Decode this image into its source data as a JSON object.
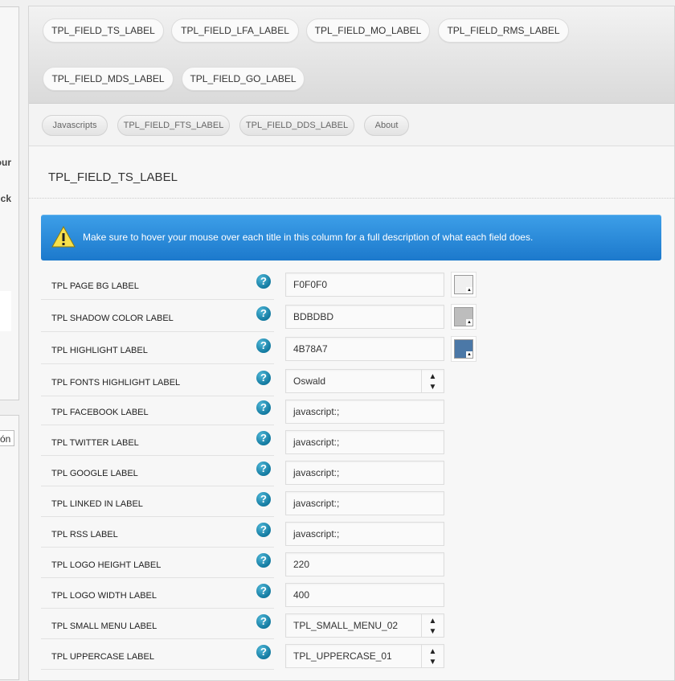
{
  "left_fragments": [
    "our",
    "ck"
  ],
  "left_input_value": "ón",
  "tabs": [
    "TPL_FIELD_TS_LABEL",
    "TPL_FIELD_LFA_LABEL",
    "TPL_FIELD_MO_LABEL",
    "TPL_FIELD_RMS_LABEL",
    "TPL_FIELD_MDS_LABEL",
    "TPL_FIELD_GO_LABEL"
  ],
  "subtabs": [
    "Javascripts",
    "TPL_FIELD_FTS_LABEL",
    "TPL_FIELD_DDS_LABEL",
    "About"
  ],
  "section_title": "TPL_FIELD_TS_LABEL",
  "alert_text": "Make sure to hover your mouse over each title in this column for a full description of what each field does.",
  "help_glyph": "?",
  "select_glyph": "▲\n▼",
  "swatch_corner_glyph": "▲",
  "rows": [
    {
      "label": "TPL PAGE BG LABEL",
      "value": "F0F0F0",
      "type": "color",
      "color": "#F0F0F0"
    },
    {
      "label": "TPL SHADOW COLOR LABEL",
      "value": "BDBDBD",
      "type": "color",
      "color": "#BDBDBD"
    },
    {
      "label": "TPL HIGHLIGHT LABEL",
      "value": "4B78A7",
      "type": "color",
      "color": "#4B78A7"
    },
    {
      "label": "TPL FONTS HIGHLIGHT LABEL",
      "value": "Oswald",
      "type": "select"
    },
    {
      "label": "TPL FACEBOOK LABEL",
      "value": "javascript:;",
      "type": "text"
    },
    {
      "label": "TPL TWITTER LABEL",
      "value": "javascript:;",
      "type": "text"
    },
    {
      "label": "TPL GOOGLE LABEL",
      "value": "javascript:;",
      "type": "text"
    },
    {
      "label": "TPL LINKED IN LABEL",
      "value": "javascript:;",
      "type": "text"
    },
    {
      "label": "TPL RSS LABEL",
      "value": "javascript:;",
      "type": "text"
    },
    {
      "label": "TPL LOGO HEIGHT LABEL",
      "value": "220",
      "type": "text"
    },
    {
      "label": "TPL LOGO WIDTH LABEL",
      "value": "400",
      "type": "text"
    },
    {
      "label": "TPL SMALL MENU LABEL",
      "value": "TPL_SMALL_MENU_02",
      "type": "select"
    },
    {
      "label": "TPL UPPERCASE LABEL",
      "value": "TPL_UPPERCASE_01",
      "type": "select"
    }
  ],
  "colors": {
    "alert_top": "#3d9fe8",
    "alert_bottom": "#1c79cc",
    "help": "#137aa0"
  }
}
